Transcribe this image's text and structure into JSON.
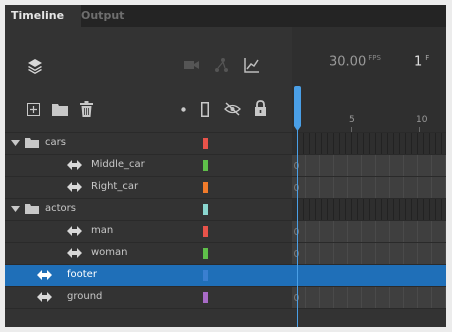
{
  "tabs": [
    {
      "label": "Timeline",
      "active": true
    },
    {
      "label": "Output",
      "active": false
    }
  ],
  "controls": {
    "fps_value": "30.00",
    "fps_unit": "FPS",
    "frame_value": "1",
    "frame_unit": "F"
  },
  "ruler": {
    "labels": [
      "5",
      "10"
    ]
  },
  "layers": [
    {
      "name": "cars",
      "type": "folder",
      "color": "#e8534a"
    },
    {
      "name": "Middle_car",
      "type": "symbol",
      "color": "#5fbf4a"
    },
    {
      "name": "Right_car",
      "type": "symbol",
      "color": "#f07b2b"
    },
    {
      "name": "actors",
      "type": "folder",
      "color": "#8ad6cf"
    },
    {
      "name": "man",
      "type": "symbol",
      "color": "#e8534a"
    },
    {
      "name": "woman",
      "type": "symbol",
      "color": "#5fbf4a"
    },
    {
      "name": "footer",
      "type": "symbol",
      "color": "#3a7fd0",
      "selected": true
    },
    {
      "name": "ground",
      "type": "symbol",
      "color": "#a86bc7"
    }
  ],
  "colors": {
    "selection": "#1f6fb8",
    "playhead": "#4a9fe6"
  }
}
